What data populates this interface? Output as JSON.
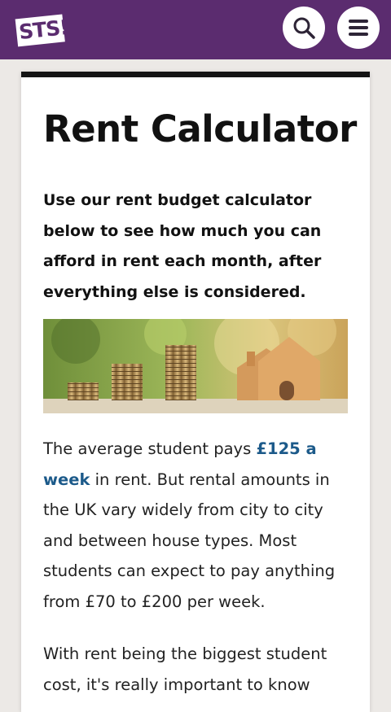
{
  "header": {
    "logo_text": "STS!",
    "colors": {
      "brand_purple": "#5b2c6f",
      "link_blue": "#1c5a8a"
    },
    "icons": [
      "search-icon",
      "menu-icon"
    ]
  },
  "article": {
    "title": "Rent Calculator",
    "intro": "Use our rent budget calculator below to see how much you can afford in rent each month, after everything else is considered.",
    "paragraph1": {
      "before": "The average student pays ",
      "highlight": "£125 a week",
      "after": " in rent. But rental amounts in the UK vary widely from city to city and between house types. Most students can expect to pay anything from £70 to £200 per week."
    },
    "paragraph2": "With rent being the biggest student cost, it's really important to know"
  }
}
